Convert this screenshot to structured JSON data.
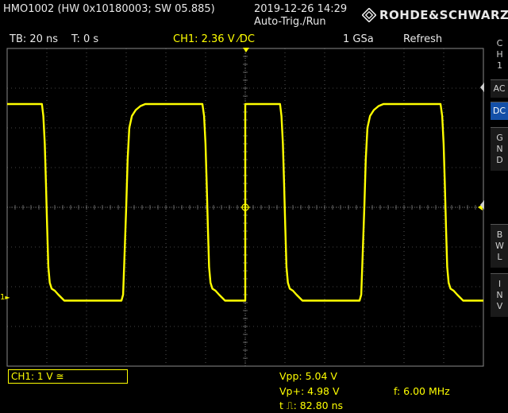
{
  "header": {
    "device": "HMO1002 (HW 0x10180003; SW 05.885)",
    "datetime": "2019-12-26 14:29",
    "trigger_mode": "Auto-Trig./Run",
    "brand": "ROHDE&SCHWARZ"
  },
  "status": {
    "timebase": "TB: 20 ns",
    "time_offset": "T: 0 s",
    "trigger_info": "CH1: 2.36 V ⁄DC",
    "sample_rate": "1 GSa",
    "acquire_mode": "Refresh"
  },
  "side_menu": {
    "channel": "CH1",
    "coupling_ac": "AC",
    "coupling_dc": "DC",
    "gnd": "GND",
    "bwl": "BWL",
    "inv": "INV"
  },
  "footer": {
    "channel_scale": "CH1: 1 V ≅",
    "vpp": "Vpp: 5.04 V",
    "vp_plus": "Vp+: 4.98 V",
    "pulse_width": "t ⎍: 82.80 ns",
    "frequency": "f: 6.00 MHz"
  },
  "markers": {
    "ground_marker": "1"
  },
  "colors": {
    "trace": "#ffff00",
    "grid": "#8a8a8a",
    "active_button": "#1450a8"
  },
  "waveform": {
    "x_range": [
      0,
      200
    ],
    "y_range": [
      -4,
      4
    ],
    "points": [
      [
        0,
        2.6
      ],
      [
        14.6,
        2.6
      ],
      [
        15.2,
        2.3
      ],
      [
        15.8,
        1.6
      ],
      [
        16.3,
        0.6
      ],
      [
        16.8,
        -0.5
      ],
      [
        17.3,
        -1.5
      ],
      [
        17.9,
        -1.9
      ],
      [
        18.7,
        -2.05
      ],
      [
        20,
        -2.1
      ],
      [
        21.5,
        -2.2
      ],
      [
        24,
        -2.35
      ],
      [
        48,
        -2.35
      ],
      [
        48.7,
        -2.2
      ],
      [
        49.3,
        -1.2
      ],
      [
        50.0,
        0.0
      ],
      [
        50.6,
        1.2
      ],
      [
        51.3,
        2.0
      ],
      [
        52.4,
        2.3
      ],
      [
        54,
        2.45
      ],
      [
        56,
        2.55
      ],
      [
        58,
        2.6
      ],
      [
        82,
        2.6
      ],
      [
        82.7,
        2.3
      ],
      [
        83.3,
        1.6
      ],
      [
        83.8,
        0.6
      ],
      [
        84.3,
        -0.5
      ],
      [
        84.8,
        -1.5
      ],
      [
        85.4,
        -1.9
      ],
      [
        86.2,
        -2.05
      ],
      [
        87.5,
        -2.1
      ],
      [
        89,
        -2.2
      ],
      [
        91.5,
        -2.35
      ],
      [
        100,
        -2.35
      ]
    ]
  }
}
